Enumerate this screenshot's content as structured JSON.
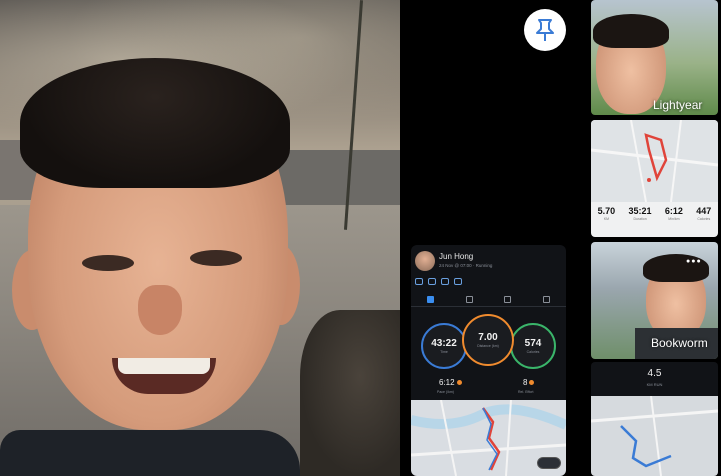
{
  "pin_button": {
    "icon": "pin-icon"
  },
  "activity_card": {
    "athlete_name": "Jun Hong",
    "date_text": "24 Nov @ 07:00 · Running",
    "tabs": [
      "summary",
      "splits",
      "charts",
      "details"
    ],
    "time": {
      "value": "43:22",
      "label": "Time"
    },
    "distance": {
      "value": "7.00",
      "label": "Distance (km)"
    },
    "calories": {
      "value": "574",
      "label": "Calories"
    },
    "pace": {
      "value": "6:12",
      "label": "Pace (/km)"
    },
    "effort": {
      "value": "8",
      "label": "Rel. Effort"
    }
  },
  "right_column": {
    "photo_1": {
      "label": "Lightyear"
    },
    "map_stats": [
      {
        "value": "5.70",
        "label": "KM"
      },
      {
        "value": "35:21",
        "label": "Duration"
      },
      {
        "value": "6:12",
        "label": "Min/km"
      },
      {
        "value": "447",
        "label": "Calories"
      }
    ],
    "photo_2": {
      "label": "Bookworm",
      "menu": "●●●"
    },
    "dark_card": {
      "value": "4.5",
      "label": "KM RUN"
    }
  },
  "colors": {
    "time_ring": "#3a7bd5",
    "distance_ring": "#f08b2e",
    "calorie_ring": "#3ab56a",
    "route": "#e0443a"
  }
}
